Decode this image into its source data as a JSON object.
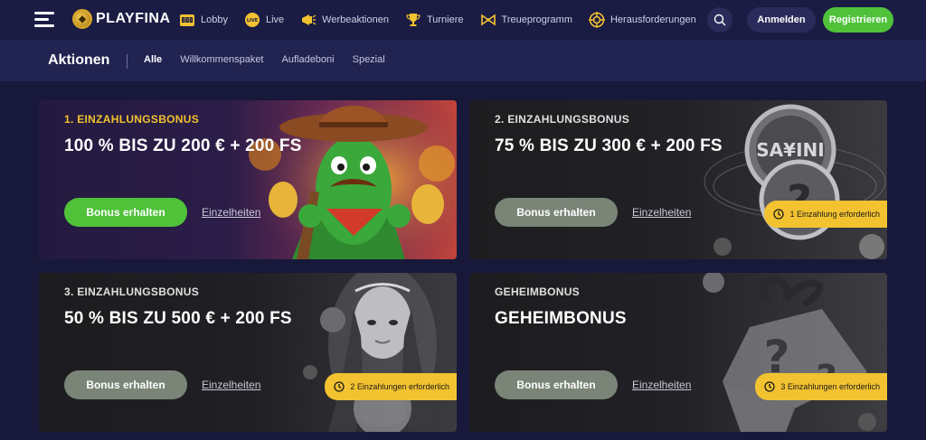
{
  "header": {
    "logo": "PLAYFINA",
    "nav": [
      {
        "label": "Lobby",
        "icon": "slot-machine-icon"
      },
      {
        "label": "Live",
        "icon": "live-icon"
      },
      {
        "label": "Werbeaktionen",
        "icon": "megaphone-icon"
      },
      {
        "label": "Turniere",
        "icon": "trophy-icon"
      },
      {
        "label": "Treueprogramm",
        "icon": "bow-icon"
      },
      {
        "label": "Herausforderungen",
        "icon": "target-icon"
      }
    ],
    "live_badge": "LIVE",
    "login_label": "Anmelden",
    "register_label": "Registrieren"
  },
  "subnav": {
    "title": "Aktionen",
    "tabs": [
      "Alle",
      "Willkommenspaket",
      "Aufladeboni",
      "Spezial"
    ],
    "active_tab": "Alle"
  },
  "cards": [
    {
      "label": "1. EINZAHLUNGSBONUS",
      "title": "100 % BIS ZU 200 € + 200 FS",
      "button": "Bonus erhalten",
      "details": "Einzelheiten",
      "badge": ""
    },
    {
      "label": "2. EINZAHLUNGSBONUS",
      "title": "75 % BIS ZU 300 € + 200 FS",
      "button": "Bonus erhalten",
      "details": "Einzelheiten",
      "badge": "1 Einzahlung erforderlich"
    },
    {
      "label": "3. EINZAHLUNGSBONUS",
      "title": "50 % BIS ZU 500 € + 200 FS",
      "button": "Bonus erhalten",
      "details": "Einzelheiten",
      "badge": "2 Einzahlungen erforderlich"
    },
    {
      "label": "GEHEIMBONUS",
      "title": "GEHEIMBONUS",
      "button": "Bonus erhalten",
      "details": "Einzelheiten",
      "badge": "3 Einzahlungen erforderlich"
    }
  ],
  "colors": {
    "accent_green": "#4fc23a",
    "badge_yellow": "#f2c230",
    "label_gold": "#f2c230",
    "disabled_button": "#7a8577"
  }
}
